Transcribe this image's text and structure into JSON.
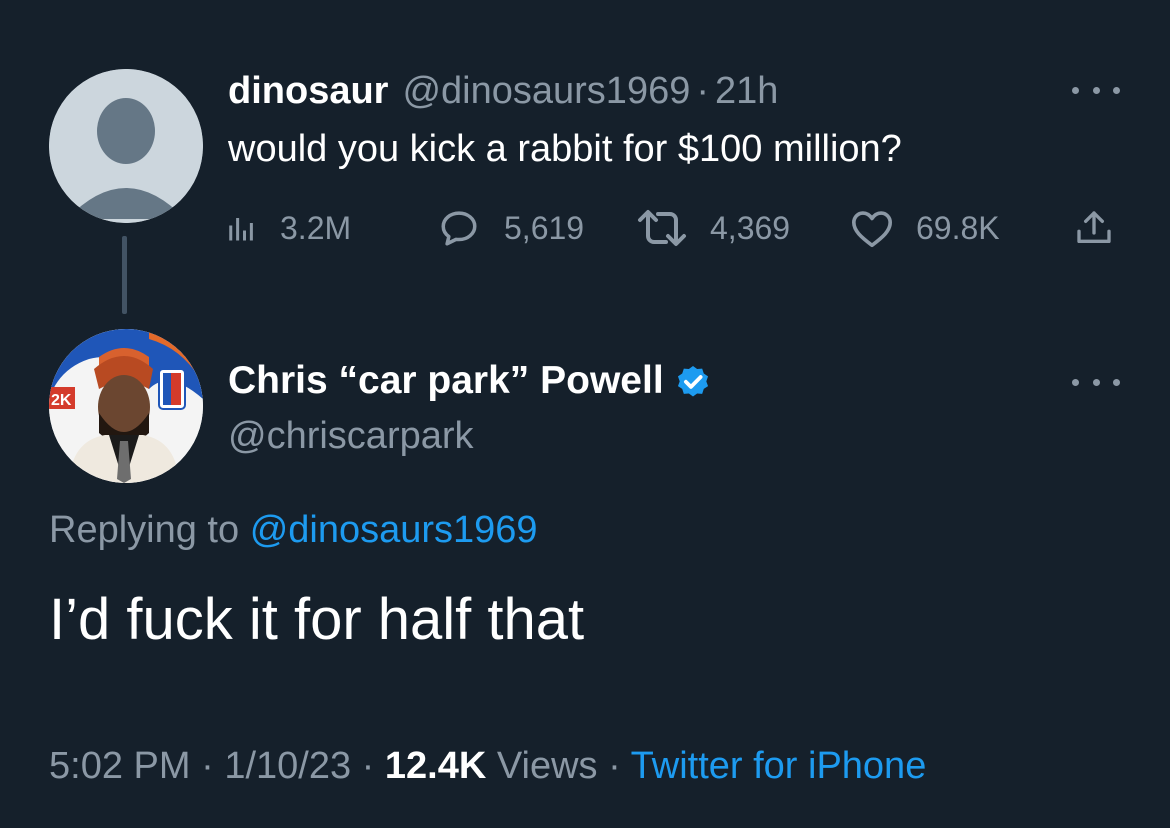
{
  "parent_tweet": {
    "display_name": "dinosaur",
    "handle": "@dinosaurs1969",
    "separator": "·",
    "time_ago": "21h",
    "text": "would you kick a rabbit for $100 million?",
    "stats": {
      "views": "3.2M",
      "replies": "5,619",
      "retweets": "4,369",
      "likes": "69.8K"
    },
    "icons": [
      "analytics-icon",
      "reply-icon",
      "retweet-icon",
      "like-icon",
      "share-icon",
      "more-icon"
    ]
  },
  "reply_tweet": {
    "display_name": "Chris “car park” Powell",
    "handle": "@chriscarpark",
    "replying_prefix": "Replying to",
    "replying_mention": "@dinosaurs1969",
    "text": "I’d fuck it for half that",
    "time": "5:02 PM",
    "date": "1/10/23",
    "separator": "·",
    "views_count": "12.4K",
    "views_label": "Views",
    "source": "Twitter for iPhone",
    "icons": [
      "verified-badge-icon",
      "more-icon"
    ]
  },
  "colors": {
    "background": "#15202b",
    "primary_text": "#ffffff",
    "secondary_text": "#8b98a5",
    "accent": "#1d9bf0",
    "thread_line": "#425364"
  }
}
